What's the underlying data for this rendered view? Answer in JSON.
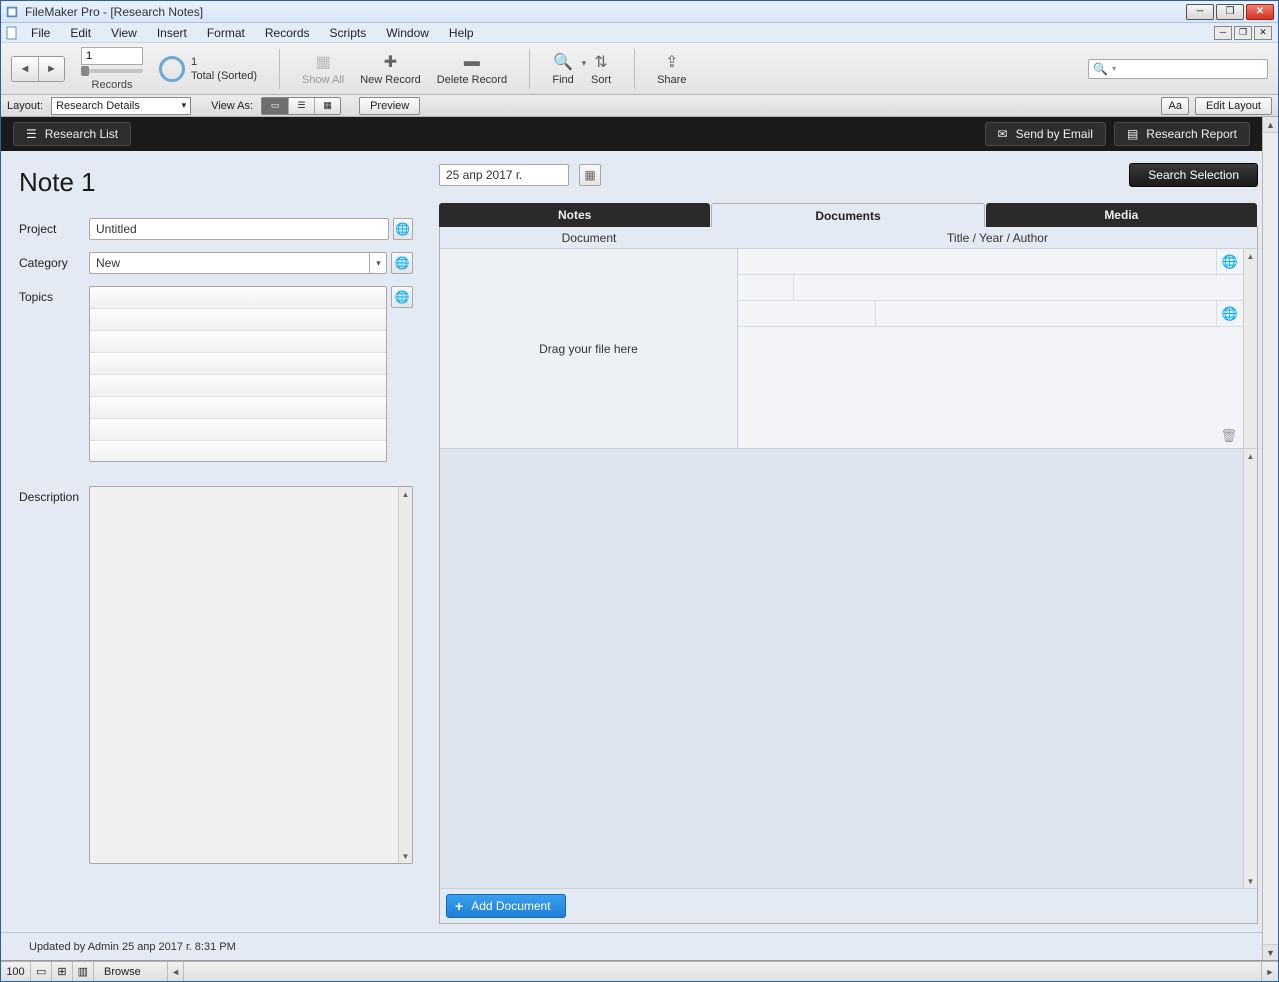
{
  "window": {
    "title": "FileMaker Pro - [Research Notes]"
  },
  "menu": [
    "File",
    "Edit",
    "View",
    "Insert",
    "Format",
    "Records",
    "Scripts",
    "Window",
    "Help"
  ],
  "toolbar": {
    "record_no": "1",
    "records_label": "Records",
    "pie_top": "1",
    "pie_bottom": "Total (Sorted)",
    "show_all": "Show All",
    "new_record": "New Record",
    "delete_record": "Delete Record",
    "find": "Find",
    "sort": "Sort",
    "share": "Share"
  },
  "layoutbar": {
    "layout_label": "Layout:",
    "layout_value": "Research Details",
    "view_as": "View As:",
    "preview": "Preview",
    "aa": "Aa",
    "edit_layout": "Edit Layout"
  },
  "darkbar": {
    "research_list": "Research List",
    "send_email": "Send by Email",
    "research_report": "Research Report"
  },
  "note": {
    "title": "Note 1",
    "date": "25 апр 2017 г.",
    "search_selection": "Search Selection",
    "labels": {
      "project": "Project",
      "category": "Category",
      "topics": "Topics",
      "description": "Description"
    },
    "project": "Untitled",
    "category": "New"
  },
  "tabs": {
    "notes": "Notes",
    "documents": "Documents",
    "media": "Media"
  },
  "doc_panel": {
    "col_document": "Document",
    "col_meta": "Title / Year / Author",
    "drop_hint": "Drag your file here",
    "add_document": "Add Document"
  },
  "footer": {
    "updated": "Updated by Admin 25 апр 2017 г. 8:31 PM"
  },
  "status": {
    "zoom": "100",
    "mode": "Browse"
  }
}
